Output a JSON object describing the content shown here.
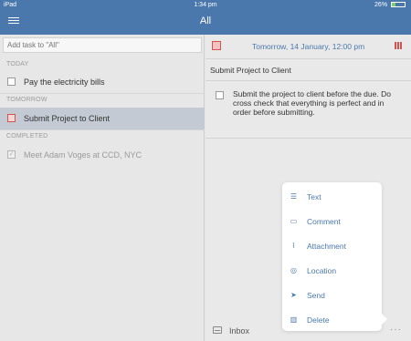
{
  "status_bar": {
    "device": "iPad",
    "time": "1:34 pm",
    "battery_label": "26%",
    "battery_level": 0.26
  },
  "nav": {
    "title": "All"
  },
  "add_task": {
    "placeholder": "Add task to \"All\""
  },
  "sections": {
    "today": "TODAY",
    "tomorrow": "TOMORROW",
    "completed": "COMPLETED"
  },
  "tasks": {
    "today": [
      {
        "label": "Pay the electricity bills"
      }
    ],
    "tomorrow": [
      {
        "label": "Submit Project to Client",
        "selected": true
      }
    ],
    "completed": [
      {
        "label": "Meet Adam Voges at CCD, NYC",
        "done": true
      }
    ]
  },
  "detail": {
    "due": "Tomorrow, 14 January, 12:00 pm",
    "title": "Submit Project to Client",
    "note": "Submit the project to client before the due. Do cross check that everything is perfect and in order before submitting.",
    "list_name": "Inbox"
  },
  "menu": {
    "items": [
      {
        "label": "Text",
        "icon": "text-icon"
      },
      {
        "label": "Comment",
        "icon": "comment-icon"
      },
      {
        "label": "Attachment",
        "icon": "attachment-icon"
      },
      {
        "label": "Location",
        "icon": "location-icon"
      },
      {
        "label": "Send",
        "icon": "send-icon"
      },
      {
        "label": "Delete",
        "icon": "trash-icon"
      }
    ]
  },
  "colors": {
    "nav_bar": "#4a78ad",
    "accent": "#4a78ad",
    "priority": "#d5534c",
    "selected_row": "#c3cad4"
  }
}
